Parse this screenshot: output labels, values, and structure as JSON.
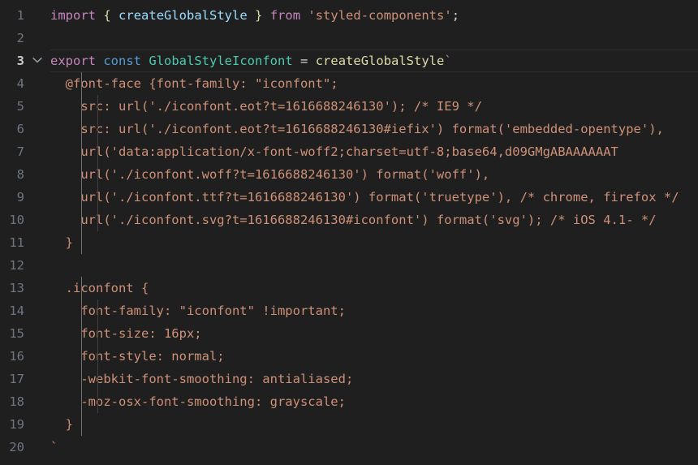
{
  "editor": {
    "language": "javascript",
    "background_color": "#1f1f1f",
    "active_line": 3,
    "line_height_px": 28,
    "first_visible_line": 1,
    "last_visible_line": 20,
    "gutter": {
      "line_numbers": [
        "1",
        "2",
        "3",
        "4",
        "5",
        "6",
        "7",
        "8",
        "9",
        "10",
        "11",
        "12",
        "13",
        "14",
        "15",
        "16",
        "17",
        "18",
        "19",
        "20"
      ],
      "active_line_number": "3",
      "fold_icon": "chevron-down-icon",
      "fold_icon_line": "3"
    },
    "colors": {
      "background": "#1f1f1f",
      "line_number": "#6e7681",
      "line_number_active": "#cccccc",
      "default_text": "#cccccc",
      "keyword_purple": "#c586c0",
      "keyword_blue": "#569cd6",
      "identifier_lightblue": "#9cdcfe",
      "function_yellow": "#dcdcaa",
      "type_teal": "#4ec9b0",
      "string_salmon": "#ce9178",
      "indent_guide": "#404040",
      "indent_guide_active": "#707070",
      "active_line_border": "#2f2f2f"
    },
    "top_partial_line": {
      "text": "/",
      "color": "#9cdcfe"
    },
    "lines": [
      {
        "number": "1",
        "indent": 0,
        "tokens": [
          {
            "text": "import",
            "kind": "keyword-purple"
          },
          {
            "text": " ",
            "kind": "plain"
          },
          {
            "text": "{",
            "kind": "brace-yellow"
          },
          {
            "text": " ",
            "kind": "plain"
          },
          {
            "text": "createGlobalStyle",
            "kind": "identifier-lightblue"
          },
          {
            "text": " ",
            "kind": "plain"
          },
          {
            "text": "}",
            "kind": "brace-yellow"
          },
          {
            "text": " ",
            "kind": "plain"
          },
          {
            "text": "from",
            "kind": "keyword-purple"
          },
          {
            "text": " ",
            "kind": "plain"
          },
          {
            "text": "'styled-components'",
            "kind": "string"
          },
          {
            "text": ";",
            "kind": "plain"
          }
        ]
      },
      {
        "number": "2",
        "indent": 0,
        "tokens": []
      },
      {
        "number": "3",
        "indent": 0,
        "tokens": [
          {
            "text": "export",
            "kind": "keyword-purple"
          },
          {
            "text": " ",
            "kind": "plain"
          },
          {
            "text": "const",
            "kind": "keyword-blue"
          },
          {
            "text": " ",
            "kind": "plain"
          },
          {
            "text": "GlobalStyleIconfont",
            "kind": "type-teal"
          },
          {
            "text": " ",
            "kind": "plain"
          },
          {
            "text": "=",
            "kind": "plain"
          },
          {
            "text": " ",
            "kind": "plain"
          },
          {
            "text": "createGlobalStyle",
            "kind": "function-yellow"
          },
          {
            "text": "`",
            "kind": "string"
          }
        ]
      },
      {
        "number": "4",
        "indent": 1,
        "tokens": [
          {
            "text": "  @font-face {font-family: \"iconfont\";",
            "kind": "string"
          }
        ]
      },
      {
        "number": "5",
        "indent": 2,
        "tokens": [
          {
            "text": "    src: url('./iconfont.eot?t=1616688246130'); /* IE9 */",
            "kind": "string"
          }
        ]
      },
      {
        "number": "6",
        "indent": 2,
        "tokens": [
          {
            "text": "    src: url('./iconfont.eot?t=1616688246130#iefix') format('embedded-opentype'),",
            "kind": "string"
          }
        ]
      },
      {
        "number": "7",
        "indent": 2,
        "tokens": [
          {
            "text": "    url('data:application/x-font-woff2;charset=utf-8;base64,d09GMgABAAAAAAT",
            "kind": "string"
          }
        ]
      },
      {
        "number": "8",
        "indent": 2,
        "tokens": [
          {
            "text": "    url('./iconfont.woff?t=1616688246130') format('woff'),",
            "kind": "string"
          }
        ]
      },
      {
        "number": "9",
        "indent": 2,
        "tokens": [
          {
            "text": "    url('./iconfont.ttf?t=1616688246130') format('truetype'), /* chrome, firefox */",
            "kind": "string"
          }
        ]
      },
      {
        "number": "10",
        "indent": 2,
        "tokens": [
          {
            "text": "    url('./iconfont.svg?t=1616688246130#iconfont') format('svg'); /* iOS 4.1- */",
            "kind": "string"
          }
        ]
      },
      {
        "number": "11",
        "indent": 1,
        "tokens": [
          {
            "text": "  }",
            "kind": "string"
          }
        ]
      },
      {
        "number": "12",
        "indent": 0,
        "tokens": []
      },
      {
        "number": "13",
        "indent": 1,
        "tokens": [
          {
            "text": "  .iconfont {",
            "kind": "string"
          }
        ]
      },
      {
        "number": "14",
        "indent": 2,
        "tokens": [
          {
            "text": "    font-family: \"iconfont\" !important;",
            "kind": "string"
          }
        ]
      },
      {
        "number": "15",
        "indent": 2,
        "tokens": [
          {
            "text": "    font-size: 16px;",
            "kind": "string"
          }
        ]
      },
      {
        "number": "16",
        "indent": 2,
        "tokens": [
          {
            "text": "    font-style: normal;",
            "kind": "string"
          }
        ]
      },
      {
        "number": "17",
        "indent": 2,
        "tokens": [
          {
            "text": "    -webkit-font-smoothing: antialiased;",
            "kind": "string"
          }
        ]
      },
      {
        "number": "18",
        "indent": 2,
        "tokens": [
          {
            "text": "    -moz-osx-font-smoothing: grayscale;",
            "kind": "string"
          }
        ]
      },
      {
        "number": "19",
        "indent": 1,
        "tokens": [
          {
            "text": "  }",
            "kind": "string"
          }
        ]
      },
      {
        "number": "20",
        "indent": 0,
        "tokens": [
          {
            "text": "`",
            "kind": "string"
          }
        ]
      }
    ]
  }
}
